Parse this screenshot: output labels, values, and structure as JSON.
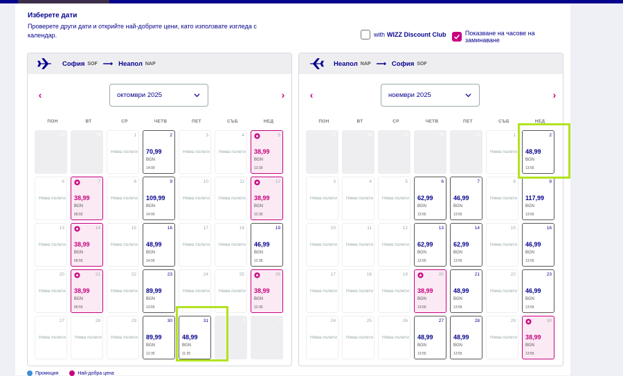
{
  "header": {
    "title": "Изберете дати",
    "subtitle": "Проверете други дати и открийте най-добрите цени, като използвате изгледа с календар."
  },
  "options": {
    "discount_pre": "with",
    "discount_brand": "WIZZ Discount Club",
    "discount_checked": false,
    "show_times_label": "Показване на часове на заминаване",
    "show_times_checked": true
  },
  "weekdays": [
    "ПОН",
    "ВТ",
    "СР",
    "ЧЕТВ",
    "ПЕТ",
    "СЪБ",
    "НЕД"
  ],
  "no_flights_text": "Няма полети",
  "calendars": [
    {
      "from_city": "София",
      "from_code": "SOF",
      "to_city": "Неапол",
      "to_code": "NAP",
      "month": "октомври 2025",
      "rows": [
        [
          {
            "n": "29",
            "t": "empty"
          },
          {
            "n": "30",
            "t": "empty"
          },
          {
            "n": "1",
            "t": "none"
          },
          {
            "n": "2",
            "t": "price",
            "p": "70,99",
            "c": "BGN",
            "h": "14:00"
          },
          {
            "n": "3",
            "t": "none"
          },
          {
            "n": "4",
            "t": "none"
          },
          {
            "n": "5",
            "t": "best",
            "p": "38,99",
            "c": "BGN",
            "h": "12:30"
          }
        ],
        [
          {
            "n": "6",
            "t": "none"
          },
          {
            "n": "7",
            "t": "best",
            "p": "38,99",
            "c": "BGN",
            "h": "06:55"
          },
          {
            "n": "8",
            "t": "none"
          },
          {
            "n": "9",
            "t": "price",
            "p": "109,99",
            "c": "BGN",
            "h": "14:00"
          },
          {
            "n": "10",
            "t": "none"
          },
          {
            "n": "11",
            "t": "none"
          },
          {
            "n": "12",
            "t": "best",
            "p": "38,99",
            "c": "BGN",
            "h": "12:30"
          }
        ],
        [
          {
            "n": "13",
            "t": "none"
          },
          {
            "n": "14",
            "t": "best",
            "p": "38,99",
            "c": "BGN",
            "h": "06:55"
          },
          {
            "n": "15",
            "t": "none"
          },
          {
            "n": "16",
            "t": "price",
            "p": "48,99",
            "c": "BGN",
            "h": "14:00"
          },
          {
            "n": "17",
            "t": "none"
          },
          {
            "n": "18",
            "t": "none"
          },
          {
            "n": "19",
            "t": "price",
            "p": "46,99",
            "c": "BGN",
            "h": "12:35"
          }
        ],
        [
          {
            "n": "20",
            "t": "none"
          },
          {
            "n": "21",
            "t": "best",
            "p": "38,99",
            "c": "BGN",
            "h": "06:55"
          },
          {
            "n": "22",
            "t": "none"
          },
          {
            "n": "23",
            "t": "price",
            "p": "89,99",
            "c": "BGN",
            "h": "13:55"
          },
          {
            "n": "24",
            "t": "none"
          },
          {
            "n": "25",
            "t": "none"
          },
          {
            "n": "26",
            "t": "best",
            "p": "38,99",
            "c": "BGN",
            "h": "12:35"
          }
        ],
        [
          {
            "n": "27",
            "t": "none"
          },
          {
            "n": "28",
            "t": "none"
          },
          {
            "n": "29",
            "t": "none"
          },
          {
            "n": "30",
            "t": "price",
            "p": "89,99",
            "c": "BGN",
            "h": "12:35"
          },
          {
            "n": "31",
            "t": "price",
            "p": "48,99",
            "c": "BGN",
            "h": "11:35"
          },
          {
            "n": "1",
            "t": "empty"
          },
          {
            "n": "2",
            "t": "empty"
          }
        ]
      ]
    },
    {
      "from_city": "Неапол",
      "from_code": "NAP",
      "to_city": "София",
      "to_code": "SOF",
      "month": "ноември 2025",
      "rows": [
        [
          {
            "n": "27",
            "t": "empty"
          },
          {
            "n": "28",
            "t": "empty"
          },
          {
            "n": "29",
            "t": "empty"
          },
          {
            "n": "30",
            "t": "empty"
          },
          {
            "n": "31",
            "t": "empty"
          },
          {
            "n": "1",
            "t": "none"
          },
          {
            "n": "2",
            "t": "price",
            "p": "48,99",
            "c": "BGN",
            "h": "13:55"
          }
        ],
        [
          {
            "n": "3",
            "t": "none"
          },
          {
            "n": "4",
            "t": "none"
          },
          {
            "n": "5",
            "t": "none"
          },
          {
            "n": "6",
            "t": "price",
            "p": "62,99",
            "c": "BGN",
            "h": "13:55"
          },
          {
            "n": "7",
            "t": "price",
            "p": "46,99",
            "c": "BGN",
            "h": "13:55"
          },
          {
            "n": "8",
            "t": "none"
          },
          {
            "n": "9",
            "t": "price",
            "p": "117,99",
            "c": "BGN",
            "h": "13:55"
          }
        ],
        [
          {
            "n": "10",
            "t": "none"
          },
          {
            "n": "11",
            "t": "none"
          },
          {
            "n": "12",
            "t": "none"
          },
          {
            "n": "13",
            "t": "price",
            "p": "62,99",
            "c": "BGN",
            "h": "13:55"
          },
          {
            "n": "14",
            "t": "price",
            "p": "62,99",
            "c": "BGN",
            "h": "13:55"
          },
          {
            "n": "15",
            "t": "none"
          },
          {
            "n": "16",
            "t": "price",
            "p": "46,99",
            "c": "BGN",
            "h": "13:55"
          }
        ],
        [
          {
            "n": "17",
            "t": "none"
          },
          {
            "n": "18",
            "t": "none"
          },
          {
            "n": "19",
            "t": "none"
          },
          {
            "n": "20",
            "t": "best",
            "p": "38,99",
            "c": "BGN",
            "h": "13:55"
          },
          {
            "n": "21",
            "t": "price",
            "p": "48,99",
            "c": "BGN",
            "h": "13:55"
          },
          {
            "n": "22",
            "t": "none"
          },
          {
            "n": "23",
            "t": "price",
            "p": "46,99",
            "c": "BGN",
            "h": "13:55"
          }
        ],
        [
          {
            "n": "24",
            "t": "none"
          },
          {
            "n": "25",
            "t": "none"
          },
          {
            "n": "26",
            "t": "none"
          },
          {
            "n": "27",
            "t": "price",
            "p": "48,99",
            "c": "BGN",
            "h": "13:55"
          },
          {
            "n": "28",
            "t": "price",
            "p": "48,99",
            "c": "BGN",
            "h": "13:55"
          },
          {
            "n": "29",
            "t": "none"
          },
          {
            "n": "30",
            "t": "best",
            "p": "38,99",
            "c": "BGN",
            "h": "13:55"
          }
        ]
      ]
    }
  ],
  "legend": {
    "promo": "Промоция",
    "best": "Най-добра цена"
  },
  "colors": {
    "brand": "#06038d",
    "best": "#c6007e",
    "highlight": "#b2e21f"
  }
}
